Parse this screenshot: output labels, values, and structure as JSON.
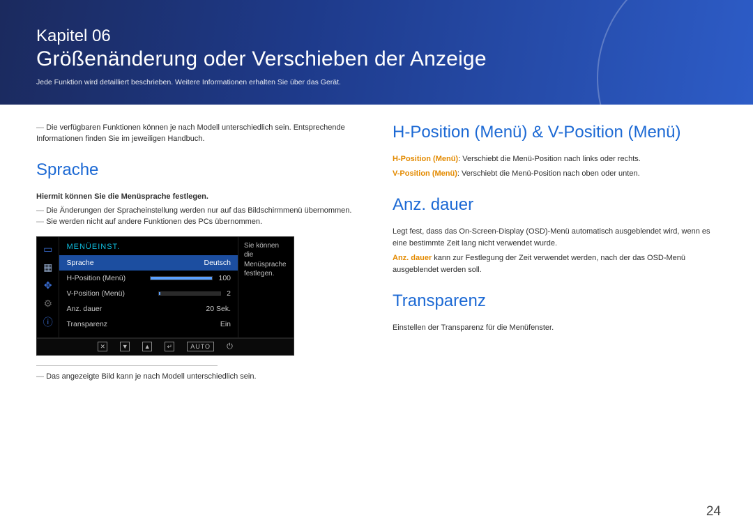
{
  "page_number": "24",
  "banner": {
    "chapter": "Kapitel 06",
    "title": "Größenänderung oder Verschieben der Anzeige",
    "sub": "Jede Funktion wird detailliert beschrieben. Weitere Informationen erhalten Sie über das Gerät."
  },
  "left": {
    "note_models": "Die verfügbaren Funktionen können je nach Modell unterschiedlich sein. Entsprechende Informationen finden Sie im jeweiligen Handbuch.",
    "section_sprache": "Sprache",
    "sprache_desc": "Hiermit können Sie die Menüsprache festlegen.",
    "sprache_note1": "Die Änderungen der Spracheinstellung werden nur auf das Bildschirmmenü übernommen.",
    "sprache_note2": "Sie werden nicht auf andere Funktionen des PCs übernommen.",
    "after_image_note": "Das angezeigte Bild kann je nach Modell unterschiedlich sein."
  },
  "osd": {
    "header": "MENÜEINST.",
    "side_help": "Sie können die Menüsprache festlegen.",
    "rows": [
      {
        "label": "Sprache",
        "value": "Deutsch",
        "selected": true,
        "slider": null
      },
      {
        "label": "H-Position (Menü)",
        "value": "100",
        "selected": false,
        "slider": 100
      },
      {
        "label": "V-Position (Menü)",
        "value": "2",
        "selected": false,
        "slider": 2
      },
      {
        "label": "Anz. dauer",
        "value": "20 Sek.",
        "selected": false,
        "slider": null
      },
      {
        "label": "Transparenz",
        "value": "Ein",
        "selected": false,
        "slider": null
      }
    ],
    "bar": {
      "auto": "AUTO"
    }
  },
  "right": {
    "sec_hv": "H-Position (Menü) & V-Position (Menü)",
    "hpos_label": "H-Position (Menü)",
    "hpos_text": ": Verschiebt die Menü-Position nach links oder rechts.",
    "vpos_label": "V-Position (Menü)",
    "vpos_text": ": Verschiebt die Menü-Position nach oben oder unten.",
    "sec_anz": "Anz. dauer",
    "anz_text1": "Legt fest, dass das On-Screen-Display (OSD)-Menü automatisch ausgeblendet wird, wenn es eine bestimmte Zeit lang nicht verwendet wurde.",
    "anz_label": "Anz. dauer",
    "anz_text2": " kann zur Festlegung der Zeit verwendet werden, nach der das OSD-Menü ausgeblendet werden soll.",
    "sec_trans": "Transparenz",
    "trans_text": "Einstellen der Transparenz für die Menüfenster."
  }
}
